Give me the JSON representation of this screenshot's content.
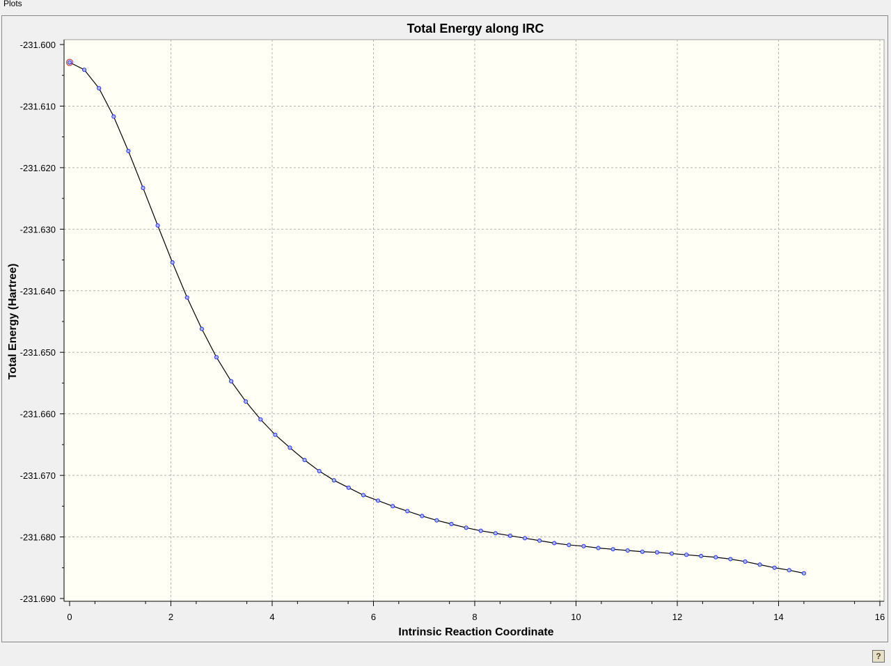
{
  "menu": {
    "plots_label": "Plots"
  },
  "colors": {
    "plot_background": "#fffff6",
    "line": "#000000",
    "marker_fill": "#a6b7ff",
    "marker_stroke": "#2020ff",
    "highlight_marker": "#c0404a",
    "grid": "#b4b4b4"
  },
  "icons": {
    "help": "help-question-icon"
  },
  "chart_data": {
    "type": "line",
    "title": "Total Energy along IRC",
    "xlabel": "Intrinsic Reaction Coordinate",
    "ylabel": "Total Energy (Hartree)",
    "xlim": [
      0,
      16
    ],
    "ylim": [
      -231.69,
      -231.6
    ],
    "x_ticks": [
      "0",
      "2",
      "4",
      "6",
      "8",
      "10",
      "12",
      "14",
      "16"
    ],
    "y_ticks": [
      "-231.600",
      "-231.610",
      "-231.620",
      "-231.630",
      "-231.640",
      "-231.650",
      "-231.660",
      "-231.670",
      "-231.680",
      "-231.690"
    ],
    "grid": true,
    "highlighted_point_index": 0,
    "series": [
      {
        "x": [
          0.0,
          0.29,
          0.58,
          0.87,
          1.16,
          1.45,
          1.74,
          2.03,
          2.32,
          2.61,
          2.9,
          3.19,
          3.48,
          3.77,
          4.06,
          4.35,
          4.64,
          4.93,
          5.22,
          5.51,
          5.8,
          6.09,
          6.38,
          6.67,
          6.96,
          7.25,
          7.54,
          7.83,
          8.12,
          8.41,
          8.7,
          8.99,
          9.28,
          9.57,
          9.86,
          10.15,
          10.44,
          10.73,
          11.02,
          11.31,
          11.6,
          11.89,
          12.18,
          12.47,
          12.76,
          13.05,
          13.34,
          13.63,
          13.92,
          14.21,
          14.5
        ],
        "y": [
          -231.6029,
          -231.6041,
          -231.6071,
          -231.6117,
          -231.6173,
          -231.6233,
          -231.6294,
          -231.6354,
          -231.6411,
          -231.6462,
          -231.6508,
          -231.6547,
          -231.658,
          -231.6609,
          -231.6634,
          -231.6655,
          -231.6675,
          -231.6693,
          -231.6708,
          -231.672,
          -231.6732,
          -231.6741,
          -231.675,
          -231.6758,
          -231.6766,
          -231.6773,
          -231.6779,
          -231.6785,
          -231.679,
          -231.6794,
          -231.6798,
          -231.6802,
          -231.6806,
          -231.681,
          -231.6813,
          -231.6815,
          -231.6818,
          -231.682,
          -231.6822,
          -231.6824,
          -231.6825,
          -231.6827,
          -231.6829,
          -231.6831,
          -231.6833,
          -231.6836,
          -231.684,
          -231.6845,
          -231.685,
          -231.6854,
          -231.6859
        ]
      }
    ]
  }
}
